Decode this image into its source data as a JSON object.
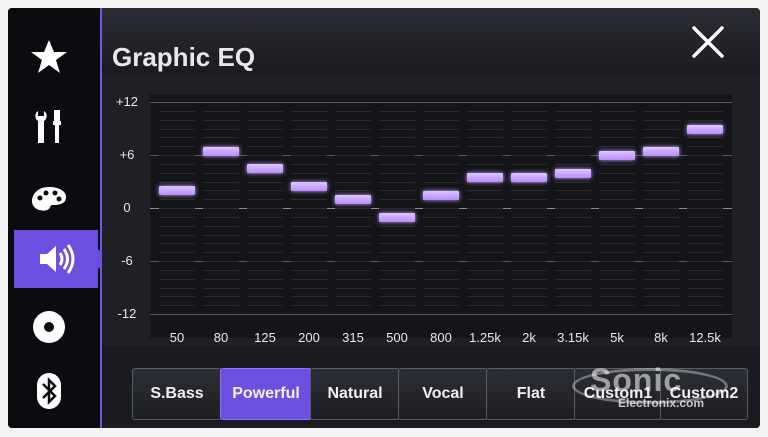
{
  "header": {
    "title": "Graphic EQ"
  },
  "sidebar": {
    "items": [
      {
        "icon": "star-icon",
        "active": false
      },
      {
        "icon": "tools-icon",
        "active": false
      },
      {
        "icon": "palette-icon",
        "active": false
      },
      {
        "icon": "speaker-icon",
        "active": true
      },
      {
        "icon": "disc-icon",
        "active": false
      },
      {
        "icon": "bluetooth-icon",
        "active": false
      }
    ]
  },
  "eq": {
    "y_labels": [
      "+12",
      "+6",
      "0",
      "-6",
      "-12"
    ],
    "y_range": [
      -12,
      12
    ],
    "bands": [
      {
        "label": "50",
        "gain": 2
      },
      {
        "label": "80",
        "gain": 6.5
      },
      {
        "label": "125",
        "gain": 4.5
      },
      {
        "label": "200",
        "gain": 2.5
      },
      {
        "label": "315",
        "gain": 1
      },
      {
        "label": "500",
        "gain": -1
      },
      {
        "label": "800",
        "gain": 1.5
      },
      {
        "label": "1.25k",
        "gain": 3.5
      },
      {
        "label": "2k",
        "gain": 3.5
      },
      {
        "label": "3.15k",
        "gain": 4
      },
      {
        "label": "5k",
        "gain": 6
      },
      {
        "label": "8k",
        "gain": 6.5
      },
      {
        "label": "12.5k",
        "gain": 9
      }
    ],
    "bar_color": "#b98cff"
  },
  "presets": [
    {
      "label": "S.Bass",
      "active": false
    },
    {
      "label": "Powerful",
      "active": true
    },
    {
      "label": "Natural",
      "active": false
    },
    {
      "label": "Vocal",
      "active": false
    },
    {
      "label": "Flat",
      "active": false
    },
    {
      "label": "Custom1",
      "active": false
    },
    {
      "label": "Custom2",
      "active": false
    }
  ],
  "watermark": {
    "main": "Sonic",
    "sub": "Electronix.com"
  },
  "colors": {
    "accent": "#6c4fe0"
  }
}
